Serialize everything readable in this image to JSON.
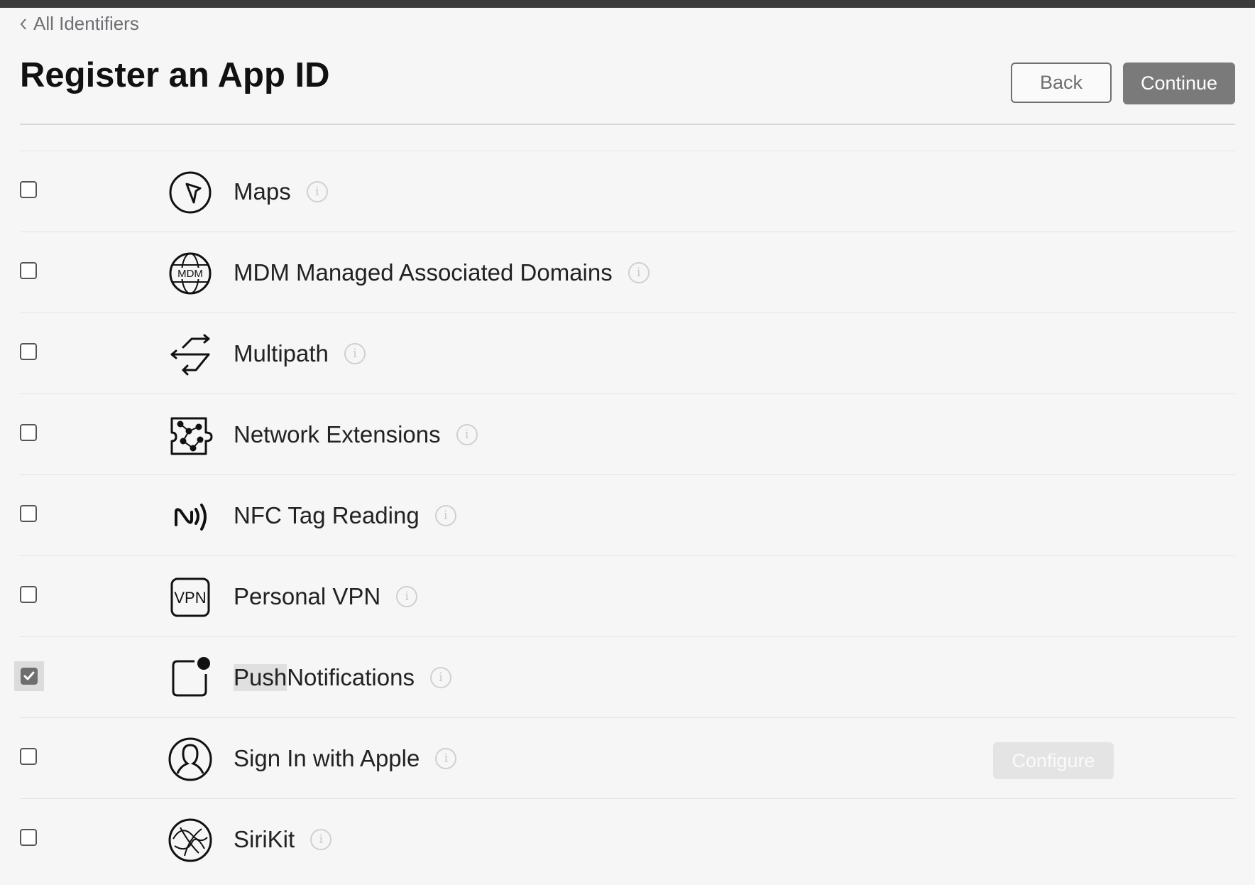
{
  "breadcrumb": {
    "label": "All Identifiers"
  },
  "page": {
    "title": "Register an App ID"
  },
  "actions": {
    "back": "Back",
    "continue": "Continue"
  },
  "info_glyph": "i",
  "capabilities": [
    {
      "label": "Maps",
      "checked": false,
      "icon": "compass-icon"
    },
    {
      "label": "MDM Managed Associated Domains",
      "checked": false,
      "icon": "mdm-globe-icon",
      "icon_text": "MDM"
    },
    {
      "label": "Multipath",
      "checked": false,
      "icon": "multipath-arrows-icon"
    },
    {
      "label": "Network Extensions",
      "checked": false,
      "icon": "network-puzzle-icon"
    },
    {
      "label": "NFC Tag Reading",
      "checked": false,
      "icon": "nfc-icon"
    },
    {
      "label": "Personal VPN",
      "checked": false,
      "icon": "vpn-icon",
      "icon_text": "VPN"
    },
    {
      "label_highlight": "Push",
      "label_rest": " Notifications",
      "checked": true,
      "icon": "push-notification-icon"
    },
    {
      "label": "Sign In with Apple",
      "checked": false,
      "icon": "user-silhouette-icon",
      "configure": "Configure"
    },
    {
      "label": "SiriKit",
      "checked": false,
      "icon": "siri-icon"
    }
  ]
}
